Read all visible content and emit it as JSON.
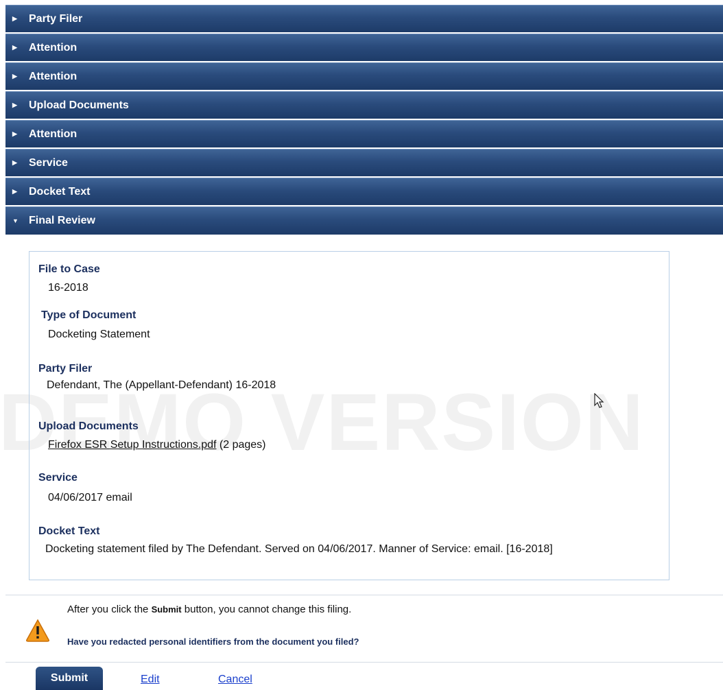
{
  "accordion": [
    {
      "label": "Party Filer",
      "open": false
    },
    {
      "label": "Attention",
      "open": false
    },
    {
      "label": "Attention",
      "open": false
    },
    {
      "label": "Upload Documents",
      "open": false
    },
    {
      "label": "Attention",
      "open": false
    },
    {
      "label": "Service",
      "open": false
    },
    {
      "label": "Docket Text",
      "open": false
    },
    {
      "label": "Final Review",
      "open": true
    }
  ],
  "review": {
    "file_to_case_label": "File to Case",
    "file_to_case_value": "16-2018",
    "doc_type_label": "Type of Document",
    "doc_type_value": "Docketing Statement",
    "party_filer_label": "Party Filer",
    "party_filer_value": "Defendant, The (Appellant-Defendant) 16-2018",
    "upload_label": "Upload Documents",
    "upload_link": "Firefox ESR Setup Instructions.pdf",
    "upload_pages": " (2 pages)",
    "service_label": "Service",
    "service_value": "04/06/2017 email",
    "docket_label": "Docket Text",
    "docket_value": "Docketing statement filed by The Defendant. Served on 04/06/2017. Manner of Service: email. [16-2018]"
  },
  "watermark": "DEMO VERSION",
  "notice": {
    "line1_pre": "After you click the ",
    "line1_bold": "Submit",
    "line1_post": " button, you cannot change this filing.",
    "line2": "Have you redacted personal identifiers from the document you filed?"
  },
  "actions": {
    "submit": "Submit",
    "edit": "Edit",
    "cancel": "Cancel"
  },
  "icons": {
    "collapsed": "triangle-right-icon",
    "expanded": "triangle-down-icon",
    "warning": "warning-icon"
  },
  "colors": {
    "header_bg": "#2a4b7c",
    "label_text": "#1b2f5e",
    "link": "#1a3fcc",
    "warning": "#f39a1c"
  }
}
